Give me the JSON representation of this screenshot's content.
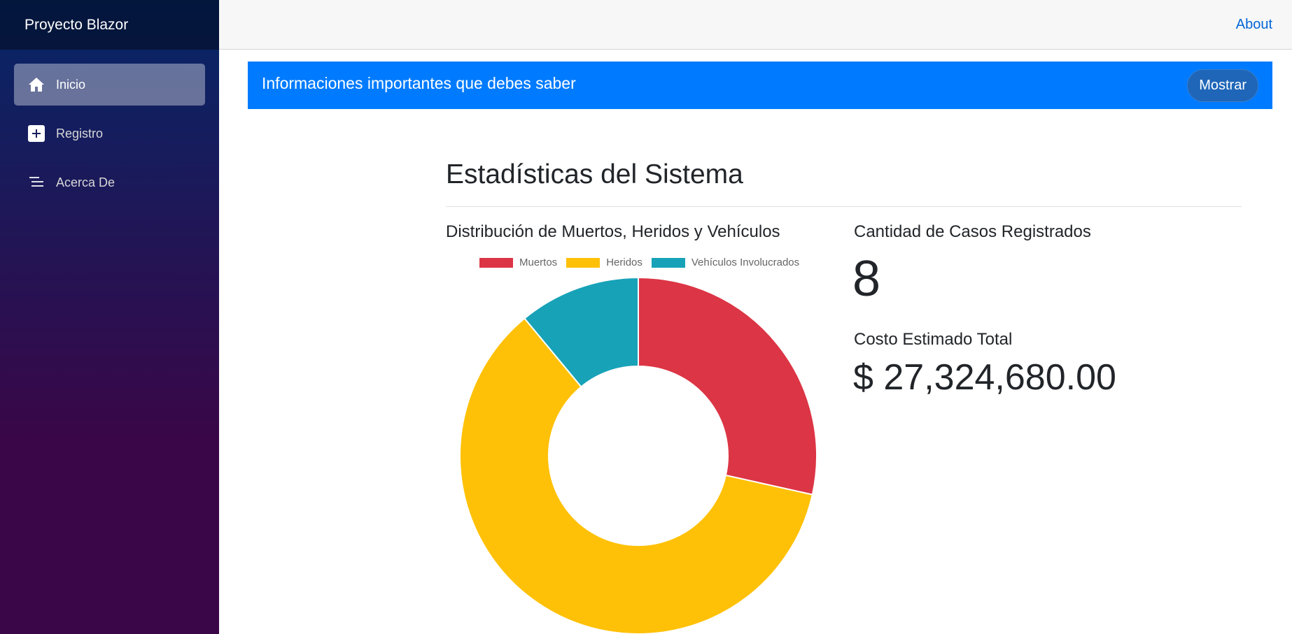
{
  "app": {
    "brand": "Proyecto Blazor"
  },
  "sidebar": {
    "items": [
      {
        "label": "Inicio",
        "icon": "home-icon",
        "active": true
      },
      {
        "label": "Registro",
        "icon": "plus-icon",
        "active": false
      },
      {
        "label": "Acerca De",
        "icon": "list-icon",
        "active": false
      }
    ]
  },
  "topbar": {
    "about_link": "About"
  },
  "banner": {
    "text": "Informaciones importantes que debes saber",
    "button": "Mostrar",
    "color": "#007bff"
  },
  "stats": {
    "title": "Estadísticas del Sistema",
    "cases_label": "Cantidad de Casos Registrados",
    "cases_value": "8",
    "cost_label": "Costo Estimado Total",
    "cost_value": "$ 27,324,680.00"
  },
  "chart_data": {
    "type": "pie",
    "variant": "doughnut",
    "title": "Distribución de Muertos, Heridos y Vehículos",
    "legend_position": "top",
    "categories": [
      "Muertos",
      "Heridos",
      "Vehículos Involucrados"
    ],
    "values": [
      28.5,
      60.5,
      11
    ],
    "colors": [
      "#dc3545",
      "#ffc107",
      "#17a2b8"
    ]
  }
}
